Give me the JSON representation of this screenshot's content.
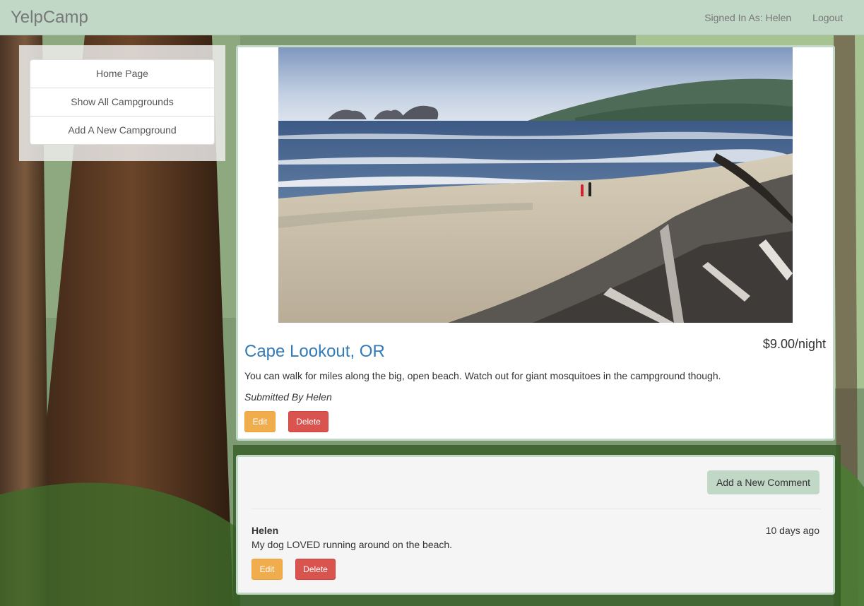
{
  "navbar": {
    "brand": "YelpCamp",
    "signed_in": "Signed In As: Helen",
    "logout": "Logout",
    "bg_color": "#c1d8c7"
  },
  "sidebar": {
    "items": [
      {
        "label": "Home Page"
      },
      {
        "label": "Show All Campgrounds"
      },
      {
        "label": "Add A New Campground"
      }
    ]
  },
  "campground": {
    "name": "Cape Lookout, OR",
    "price": "$9.00/night",
    "description": "You can walk for miles along the big, open beach. Watch out for giant mosquitoes in the campground though.",
    "submitted_by": "Submitted By Helen",
    "edit_label": "Edit",
    "delete_label": "Delete",
    "image_icon": "beach-photo"
  },
  "comments": {
    "add_label": "Add a New Comment",
    "items": [
      {
        "author": "Helen",
        "time": "10 days ago",
        "text": "My dog LOVED running around on the beach.",
        "edit_label": "Edit",
        "delete_label": "Delete"
      }
    ]
  },
  "colors": {
    "accent": "#c1d8c7",
    "link": "#337ab7",
    "warning": "#f0ad4e",
    "danger": "#d9534f"
  }
}
